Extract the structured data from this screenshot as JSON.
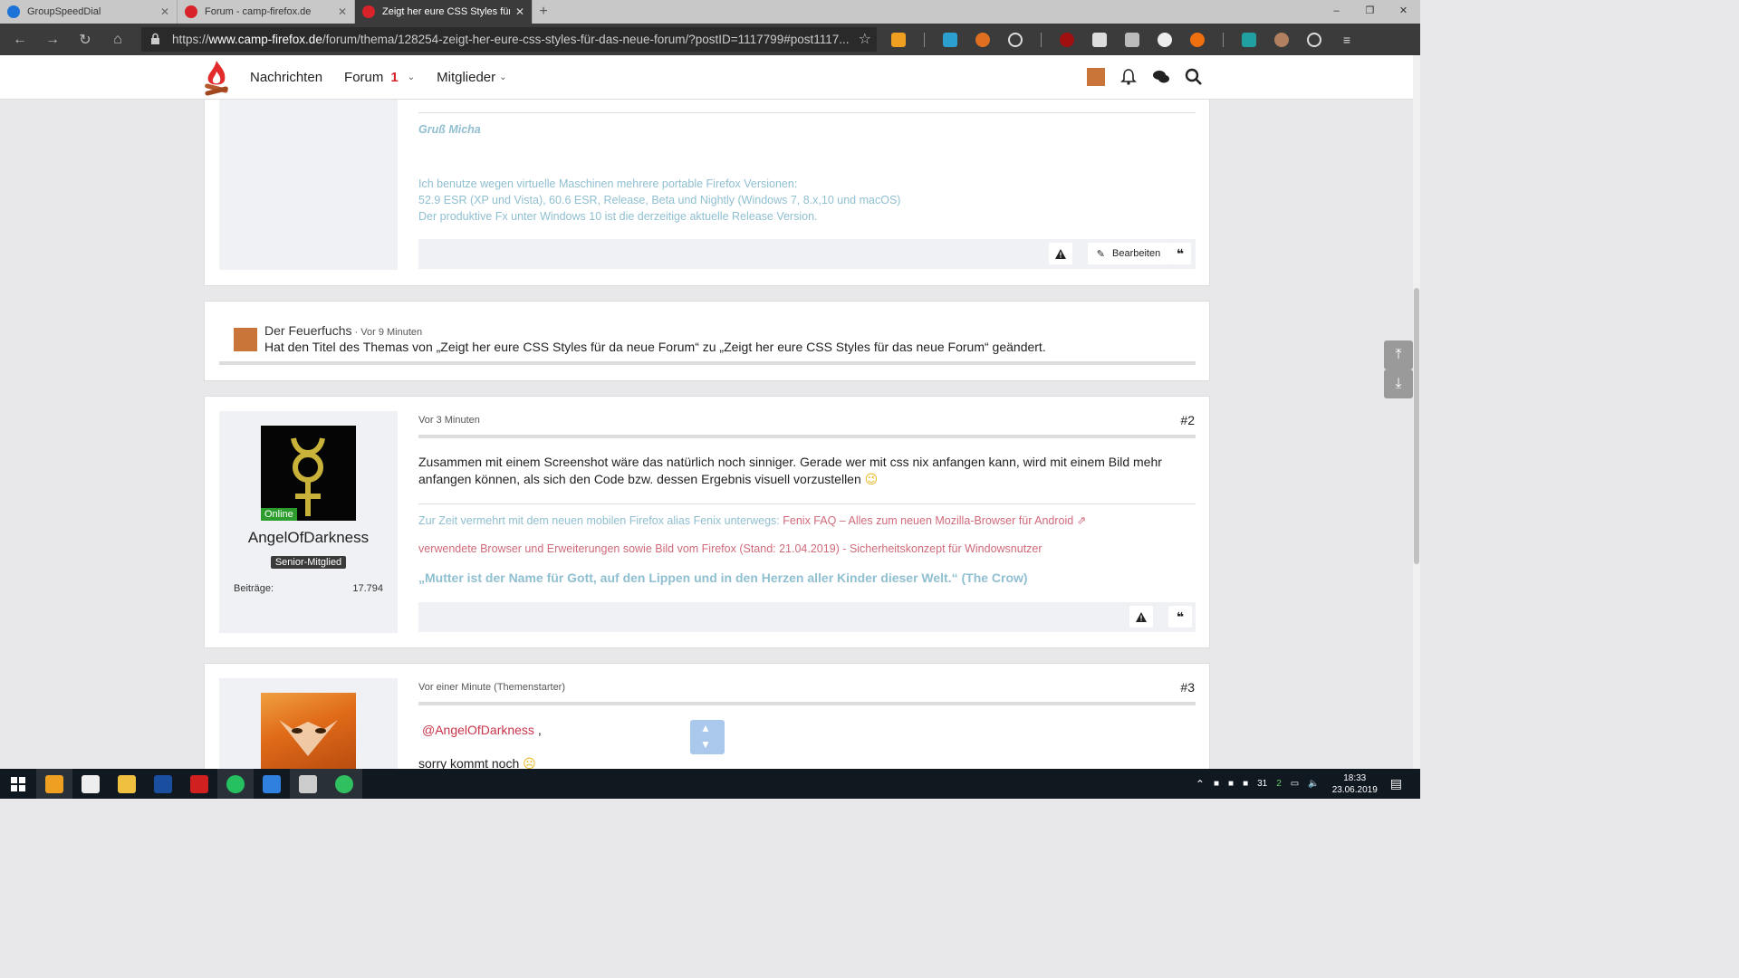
{
  "tabs": [
    {
      "title": "GroupSpeedDial",
      "color": "#1e73d8",
      "active": false
    },
    {
      "title": "Forum - camp-firefox.de",
      "color": "#d8232a",
      "active": false
    },
    {
      "title": "Zeigt her eure CSS Styles für das",
      "color": "#d8232a",
      "active": true
    }
  ],
  "newtab_label": "+",
  "window_controls": [
    "–",
    "❐",
    "✕"
  ],
  "url": {
    "prefix": "https://",
    "domain": "www.camp-firefox.de",
    "path": "/forum/thema/128254-zeigt-her-eure-css-styles-für-das-neue-forum/?postID=1117799#post1117..."
  },
  "site_nav": {
    "news": "Nachrichten",
    "forum": "Forum",
    "forum_badge": "1",
    "members": "Mitglieder"
  },
  "post_top": {
    "greeting": "Gruß Micha",
    "sig_lines": [
      "Ich benutze wegen virtuelle Maschinen mehrere portable Firefox Versionen:",
      "52.9 ESR (XP und Vista), 60.6 ESR, Release, Beta und Nightly (Windows 7, 8.x,10 und macOS)",
      "Der produktive Fx unter Windows 10 ist die derzeitige aktuelle Release Version."
    ],
    "edit_label": "Bearbeiten"
  },
  "change_notice": {
    "author": "Der Feuerfuchs",
    "time": " · Vor 9 Minuten",
    "text": "Hat den Titel des Themas von „Zeigt her eure CSS Styles für da neue Forum“ zu „Zeigt her eure CSS Styles für das neue Forum“ geändert."
  },
  "post2": {
    "time": "Vor 3 Minuten",
    "number": "#2",
    "username": "AngelOfDarkness",
    "online": "Online",
    "rank": "Senior-Mitglied",
    "stat_label": "Beiträge:",
    "stat_value": "17.794",
    "text1": "Zusammen mit einem Screenshot wäre das natürlich noch sinniger. Gerade wer mit css nix anfangen kann, wird mit einem Bild mehr",
    "text2": "anfangen können, als sich den Code bzw. dessen Ergebnis visuell vorzustellen",
    "emoji": "😉",
    "sig1_text": "Zur Zeit vermehrt mit dem neuen mobilen Firefox alias Fenix unterwegs: ",
    "sig1_link": "Fenix FAQ – Alles zum neuen Mozilla-Browser für Android",
    "sig2_link1": "verwendete Browser und Erweiterungen sowie Bild vom Firefox (Stand: 21.04.2019)",
    "sig2_sep": " - ",
    "sig2_link2": "Sicherheitskonzept für Windowsnutzer",
    "quote": "„Mutter ist der Name für Gott, auf den Lippen und in den Herzen aller Kinder dieser Welt.“ (The Crow)"
  },
  "post3": {
    "time": "Vor einer Minute (Themenstarter)",
    "number": "#3",
    "mention": "@AngelOfDarkness",
    "comma": " ,",
    "text": "sorry kommt noch",
    "emoji": "☹"
  },
  "clock": {
    "time": "18:33",
    "date": "23.06.2019"
  },
  "tray_numbers": [
    "31",
    "2"
  ]
}
